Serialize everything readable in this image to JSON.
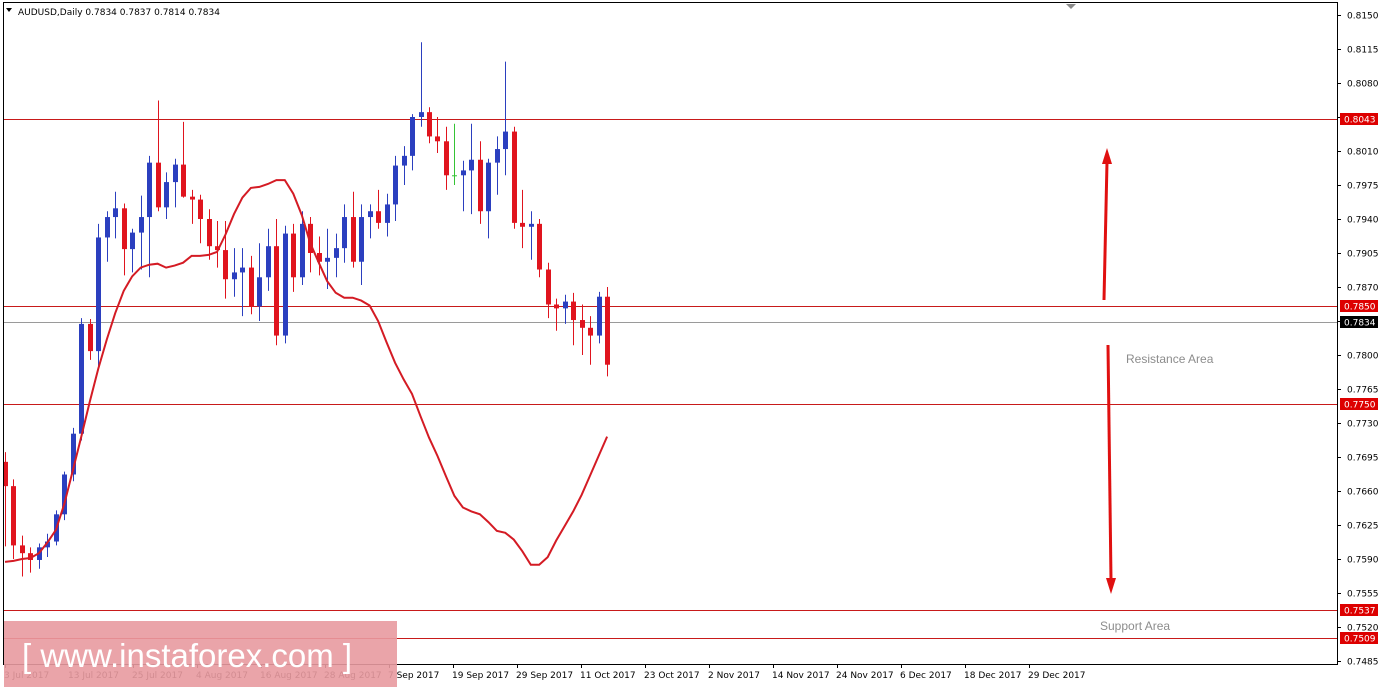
{
  "colors": {
    "background": "#ffffff",
    "bull_candle": "#2b3fbf",
    "bear_candle": "#e0141e",
    "doji_candle": "#35c435",
    "moving_average": "#d41b24",
    "level_line": "#c81a1a",
    "price_tag": "#dd0000",
    "current_tag": "#000000",
    "watermark": "#e89aa0"
  },
  "header": {
    "arrow_icon": "triangle-down-icon",
    "title": "AUDUSD,Daily  0.7834 0.7837 0.7814 0.7834"
  },
  "annotations": {
    "resistance_label": "Resistance Area",
    "support_label": "Support Area"
  },
  "watermark": {
    "text": "[ www.instaforex.com ]"
  },
  "chart_data": {
    "type": "candlestick",
    "symbol": "AUDUSD",
    "timeframe": "Daily",
    "ohlc_header": {
      "open": 0.7834,
      "high": 0.7837,
      "low": 0.7814,
      "close": 0.7834
    },
    "ylim": [
      0.7475,
      0.8155
    ],
    "y_ticks": [
      "0.8150",
      "0.8115",
      "0.8080",
      "0.8045",
      "0.8010",
      "0.7975",
      "0.7940",
      "0.7905",
      "0.7870",
      "0.7835",
      "0.7800",
      "0.7765",
      "0.7730",
      "0.7695",
      "0.7660",
      "0.7625",
      "0.7590",
      "0.7555",
      "0.7520",
      "0.7485"
    ],
    "x_ticks": [
      "3 Jul 2017",
      "13 Jul 2017",
      "25 Jul 2017",
      "4 Aug 2017",
      "16 Aug 2017",
      "28 Aug 2017",
      "7 Sep 2017",
      "19 Sep 2017",
      "29 Sep 2017",
      "11 Oct 2017",
      "23 Oct 2017",
      "2 Nov 2017",
      "14 Nov 2017",
      "24 Nov 2017",
      "6 Dec 2017",
      "18 Dec 2017",
      "29 Dec 2017"
    ],
    "levels": [
      {
        "price": 0.8043,
        "label": "0.8043"
      },
      {
        "price": 0.785,
        "label": "0.7850"
      },
      {
        "price": 0.775,
        "label": "0.7750"
      },
      {
        "price": 0.7537,
        "label": "0.7537"
      },
      {
        "price": 0.7509,
        "label": "0.7509"
      }
    ],
    "current_price": {
      "price": 0.7834,
      "label": "0.7834"
    },
    "ma_series": {
      "values": [
        0.7587,
        0.7588,
        0.759,
        0.7591,
        0.7596,
        0.7607,
        0.762,
        0.7647,
        0.7681,
        0.7716,
        0.7752,
        0.7786,
        0.7816,
        0.7843,
        0.7866,
        0.7881,
        0.789,
        0.7893,
        0.7894,
        0.789,
        0.7892,
        0.7895,
        0.7902,
        0.7902,
        0.7903,
        0.7906,
        0.7924,
        0.7945,
        0.7962,
        0.7972,
        0.7973,
        0.7976,
        0.798,
        0.798,
        0.7966,
        0.7944,
        0.7915,
        0.7895,
        0.7876,
        0.7864,
        0.7859,
        0.7859,
        0.7856,
        0.7851,
        0.7835,
        0.7813,
        0.7792,
        0.7775,
        0.776,
        0.7737,
        0.7715,
        0.7696,
        0.7675,
        0.7655,
        0.7643,
        0.7639,
        0.7636,
        0.7628,
        0.7619,
        0.7617,
        0.761,
        0.7598,
        0.7584,
        0.7584,
        0.7592,
        0.7609,
        0.7624,
        0.7639,
        0.7656,
        0.7676,
        0.7696,
        0.7716
      ]
    },
    "candles": [
      {
        "o": 0.769,
        "h": 0.77,
        "l": 0.7603,
        "c": 0.7665
      },
      {
        "o": 0.7665,
        "h": 0.7672,
        "l": 0.759,
        "c": 0.7604
      },
      {
        "o": 0.7604,
        "h": 0.7614,
        "l": 0.7572,
        "c": 0.7596
      },
      {
        "o": 0.7596,
        "h": 0.7602,
        "l": 0.7576,
        "c": 0.7589
      },
      {
        "o": 0.7589,
        "h": 0.7606,
        "l": 0.758,
        "c": 0.7602
      },
      {
        "o": 0.7602,
        "h": 0.7616,
        "l": 0.7592,
        "c": 0.7608
      },
      {
        "o": 0.7608,
        "h": 0.764,
        "l": 0.7604,
        "c": 0.7636
      },
      {
        "o": 0.7636,
        "h": 0.768,
        "l": 0.763,
        "c": 0.7677
      },
      {
        "o": 0.7677,
        "h": 0.7725,
        "l": 0.767,
        "c": 0.7719
      },
      {
        "o": 0.7719,
        "h": 0.7838,
        "l": 0.7712,
        "c": 0.7832
      },
      {
        "o": 0.7832,
        "h": 0.7837,
        "l": 0.7795,
        "c": 0.7804
      },
      {
        "o": 0.7804,
        "h": 0.7935,
        "l": 0.7785,
        "c": 0.7921
      },
      {
        "o": 0.7921,
        "h": 0.7948,
        "l": 0.7896,
        "c": 0.7942
      },
      {
        "o": 0.7942,
        "h": 0.7968,
        "l": 0.792,
        "c": 0.7951
      },
      {
        "o": 0.7951,
        "h": 0.7956,
        "l": 0.7882,
        "c": 0.7909
      },
      {
        "o": 0.7909,
        "h": 0.793,
        "l": 0.7885,
        "c": 0.7926
      },
      {
        "o": 0.7926,
        "h": 0.7964,
        "l": 0.7888,
        "c": 0.7942
      },
      {
        "o": 0.7942,
        "h": 0.8005,
        "l": 0.788,
        "c": 0.7998
      },
      {
        "o": 0.7998,
        "h": 0.8062,
        "l": 0.7948,
        "c": 0.7952
      },
      {
        "o": 0.7952,
        "h": 0.7988,
        "l": 0.794,
        "c": 0.7978
      },
      {
        "o": 0.7978,
        "h": 0.8002,
        "l": 0.7952,
        "c": 0.7996
      },
      {
        "o": 0.7996,
        "h": 0.804,
        "l": 0.7962,
        "c": 0.7963
      },
      {
        "o": 0.7963,
        "h": 0.797,
        "l": 0.7935,
        "c": 0.796
      },
      {
        "o": 0.796,
        "h": 0.7965,
        "l": 0.7915,
        "c": 0.794
      },
      {
        "o": 0.794,
        "h": 0.795,
        "l": 0.7898,
        "c": 0.7912
      },
      {
        "o": 0.7912,
        "h": 0.7938,
        "l": 0.789,
        "c": 0.7908
      },
      {
        "o": 0.7908,
        "h": 0.7938,
        "l": 0.7858,
        "c": 0.7878
      },
      {
        "o": 0.7878,
        "h": 0.791,
        "l": 0.786,
        "c": 0.7885
      },
      {
        "o": 0.7885,
        "h": 0.791,
        "l": 0.784,
        "c": 0.789
      },
      {
        "o": 0.789,
        "h": 0.7902,
        "l": 0.7842,
        "c": 0.785
      },
      {
        "o": 0.785,
        "h": 0.7915,
        "l": 0.7835,
        "c": 0.788
      },
      {
        "o": 0.788,
        "h": 0.793,
        "l": 0.7866,
        "c": 0.7912
      },
      {
        "o": 0.7912,
        "h": 0.794,
        "l": 0.781,
        "c": 0.782
      },
      {
        "o": 0.782,
        "h": 0.7933,
        "l": 0.7812,
        "c": 0.7925
      },
      {
        "o": 0.7925,
        "h": 0.7935,
        "l": 0.7865,
        "c": 0.788
      },
      {
        "o": 0.788,
        "h": 0.7948,
        "l": 0.7872,
        "c": 0.7935
      },
      {
        "o": 0.7935,
        "h": 0.7942,
        "l": 0.7885,
        "c": 0.7905
      },
      {
        "o": 0.7905,
        "h": 0.7922,
        "l": 0.7882,
        "c": 0.7896
      },
      {
        "o": 0.7896,
        "h": 0.793,
        "l": 0.7868,
        "c": 0.79
      },
      {
        "o": 0.79,
        "h": 0.7925,
        "l": 0.788,
        "c": 0.791
      },
      {
        "o": 0.791,
        "h": 0.7955,
        "l": 0.7895,
        "c": 0.7942
      },
      {
        "o": 0.7942,
        "h": 0.7968,
        "l": 0.789,
        "c": 0.7896
      },
      {
        "o": 0.7896,
        "h": 0.7955,
        "l": 0.7872,
        "c": 0.7942
      },
      {
        "o": 0.7942,
        "h": 0.7955,
        "l": 0.792,
        "c": 0.7948
      },
      {
        "o": 0.7948,
        "h": 0.797,
        "l": 0.793,
        "c": 0.7936
      },
      {
        "o": 0.7936,
        "h": 0.7966,
        "l": 0.7922,
        "c": 0.7955
      },
      {
        "o": 0.7955,
        "h": 0.8005,
        "l": 0.7938,
        "c": 0.7995
      },
      {
        "o": 0.7995,
        "h": 0.8015,
        "l": 0.7975,
        "c": 0.8005
      },
      {
        "o": 0.8005,
        "h": 0.8048,
        "l": 0.799,
        "c": 0.8045
      },
      {
        "o": 0.8045,
        "h": 0.8122,
        "l": 0.8035,
        "c": 0.805
      },
      {
        "o": 0.805,
        "h": 0.8055,
        "l": 0.8018,
        "c": 0.8025
      },
      {
        "o": 0.8025,
        "h": 0.8045,
        "l": 0.8008,
        "c": 0.802
      },
      {
        "o": 0.802,
        "h": 0.8035,
        "l": 0.797,
        "c": 0.7985
      },
      {
        "o": 0.7985,
        "h": 0.8038,
        "l": 0.7975,
        "c": 0.7985
      },
      {
        "o": 0.7985,
        "h": 0.8,
        "l": 0.7948,
        "c": 0.799
      },
      {
        "o": 0.799,
        "h": 0.8038,
        "l": 0.7945,
        "c": 0.8001
      },
      {
        "o": 0.8001,
        "h": 0.802,
        "l": 0.7935,
        "c": 0.7948
      },
      {
        "o": 0.7948,
        "h": 0.8002,
        "l": 0.792,
        "c": 0.7998
      },
      {
        "o": 0.7998,
        "h": 0.8025,
        "l": 0.7965,
        "c": 0.8012
      },
      {
        "o": 0.8012,
        "h": 0.8102,
        "l": 0.7985,
        "c": 0.803
      },
      {
        "o": 0.803,
        "h": 0.8035,
        "l": 0.793,
        "c": 0.7936
      },
      {
        "o": 0.7936,
        "h": 0.797,
        "l": 0.791,
        "c": 0.7932
      },
      {
        "o": 0.7932,
        "h": 0.7948,
        "l": 0.7898,
        "c": 0.7935
      },
      {
        "o": 0.7935,
        "h": 0.794,
        "l": 0.788,
        "c": 0.7888
      },
      {
        "o": 0.7888,
        "h": 0.7895,
        "l": 0.7838,
        "c": 0.7852
      },
      {
        "o": 0.7852,
        "h": 0.7858,
        "l": 0.7825,
        "c": 0.7848
      },
      {
        "o": 0.7848,
        "h": 0.7862,
        "l": 0.7832,
        "c": 0.7855
      },
      {
        "o": 0.7855,
        "h": 0.7864,
        "l": 0.781,
        "c": 0.7836
      },
      {
        "o": 0.7836,
        "h": 0.7852,
        "l": 0.78,
        "c": 0.7828
      },
      {
        "o": 0.7828,
        "h": 0.784,
        "l": 0.779,
        "c": 0.782
      },
      {
        "o": 0.782,
        "h": 0.7865,
        "l": 0.7812,
        "c": 0.786
      },
      {
        "o": 0.786,
        "h": 0.787,
        "l": 0.7778,
        "c": 0.779
      }
    ]
  }
}
